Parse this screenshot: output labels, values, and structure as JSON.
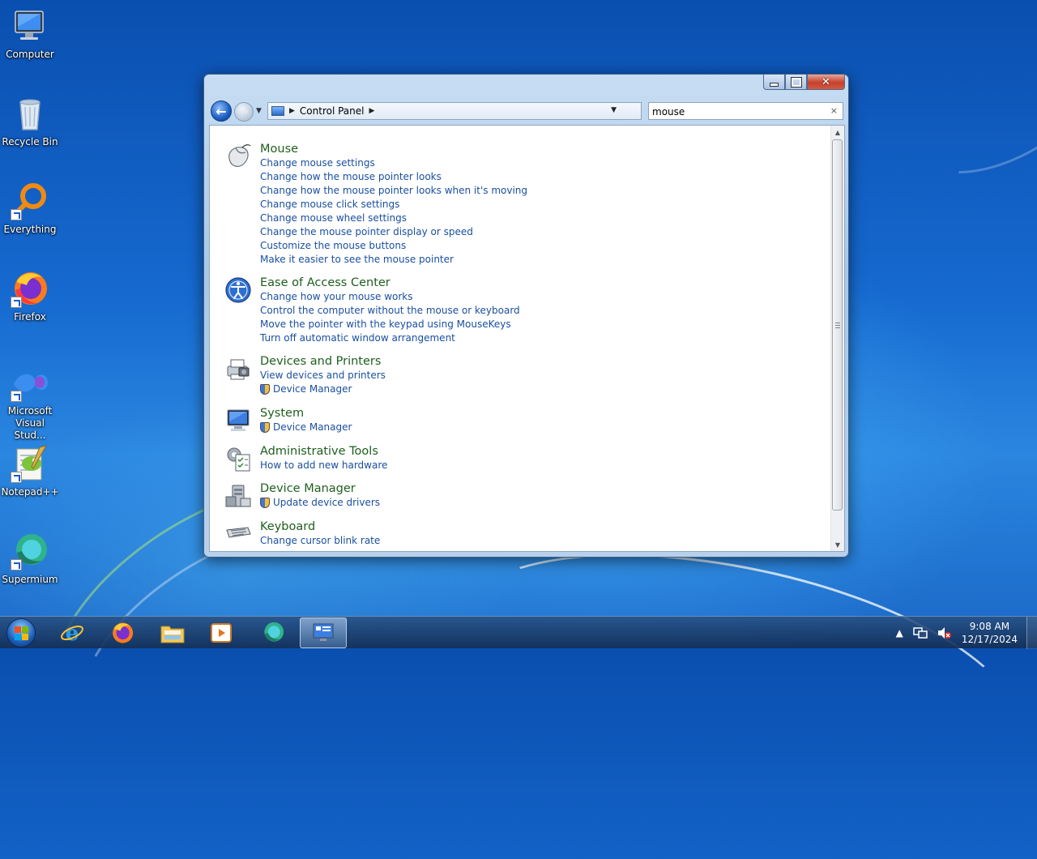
{
  "desktop": {
    "icons": [
      {
        "label": "Computer"
      },
      {
        "label": "Recycle Bin"
      },
      {
        "label": "Everything"
      },
      {
        "label": "Firefox"
      },
      {
        "label": "Microsoft Visual Stud..."
      },
      {
        "label": "Notepad++"
      },
      {
        "label": "Supermium"
      }
    ]
  },
  "window": {
    "caption_buttons": {
      "minimize": "minimize",
      "maximize": "maximize",
      "close": "✕"
    },
    "address": {
      "location": "Control Panel"
    },
    "search": {
      "value": "mouse",
      "clear": "×"
    },
    "results": [
      {
        "title": "Mouse",
        "icon": "mouse-icon",
        "links": [
          {
            "text": "Change mouse settings"
          },
          {
            "text": "Change how the mouse pointer looks"
          },
          {
            "text": "Change how the mouse pointer looks when it's moving"
          },
          {
            "text": "Change mouse click settings"
          },
          {
            "text": "Change mouse wheel settings"
          },
          {
            "text": "Change the mouse pointer display or speed"
          },
          {
            "text": "Customize the mouse buttons"
          },
          {
            "text": "Make it easier to see the mouse pointer"
          }
        ]
      },
      {
        "title": "Ease of Access Center",
        "icon": "ease-of-access-icon",
        "links": [
          {
            "text": "Change how your mouse works"
          },
          {
            "text": "Control the computer without the mouse or keyboard"
          },
          {
            "text": "Move the pointer with the keypad using MouseKeys"
          },
          {
            "text": "Turn off automatic window arrangement"
          }
        ]
      },
      {
        "title": "Devices and Printers",
        "icon": "printer-icon",
        "links": [
          {
            "text": "View devices and printers"
          },
          {
            "text": "Device Manager",
            "shield": true
          }
        ]
      },
      {
        "title": "System",
        "icon": "system-icon",
        "links": [
          {
            "text": "Device Manager",
            "shield": true
          }
        ]
      },
      {
        "title": "Administrative Tools",
        "icon": "admin-tools-icon",
        "links": [
          {
            "text": "How to add new hardware"
          }
        ]
      },
      {
        "title": "Device Manager",
        "icon": "device-manager-icon",
        "links": [
          {
            "text": "Update device drivers",
            "shield": true
          }
        ]
      },
      {
        "title": "Keyboard",
        "icon": "keyboard-icon",
        "links": [
          {
            "text": "Change cursor blink rate"
          }
        ]
      }
    ]
  },
  "taskbar": {
    "apps": [
      "internet-explorer",
      "firefox",
      "file-explorer",
      "media-player",
      "supermium",
      "control-panel"
    ],
    "clock": {
      "time": "9:08 AM",
      "date": "12/17/2024"
    }
  },
  "colors": {
    "link": "#1a4fa0",
    "heading": "#1e5e1e",
    "taskbar": "#1b3a66",
    "close_button": "#c7402e"
  }
}
